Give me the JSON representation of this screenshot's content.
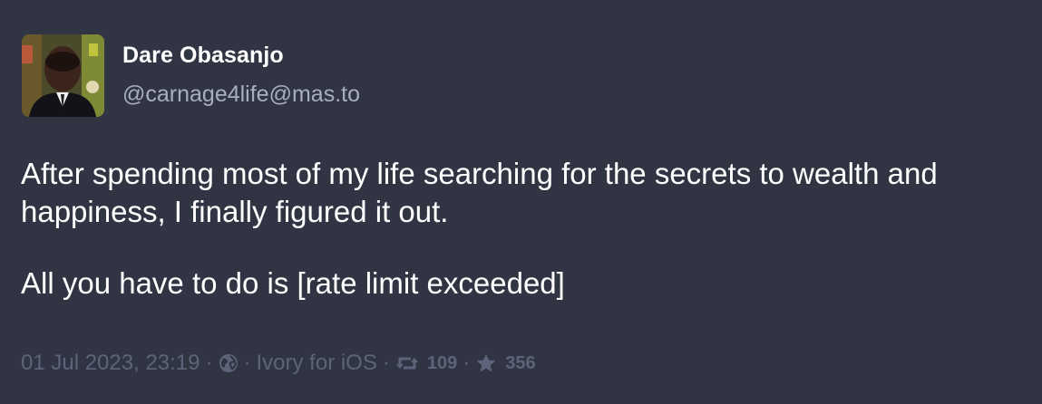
{
  "author": {
    "display_name": "Dare Obasanjo",
    "handle": "@carnage4life@mas.to"
  },
  "post": {
    "paragraphs": [
      "After spending most of my life searching for the secrets to wealth and happiness, I finally figured it out.",
      "All you have to do is [rate limit exceeded]"
    ]
  },
  "meta": {
    "timestamp": "01 Jul 2023, 23:19",
    "separator": "·",
    "visibility_icon": "globe-icon",
    "client": "Ivory for iOS",
    "boost_icon": "boost-icon",
    "boosts": "109",
    "favourite_icon": "star-icon",
    "favourites": "356"
  },
  "colors": {
    "background": "#313543",
    "text": "#ffffff",
    "handle": "#a9adc1",
    "meta": "#5d6378"
  }
}
